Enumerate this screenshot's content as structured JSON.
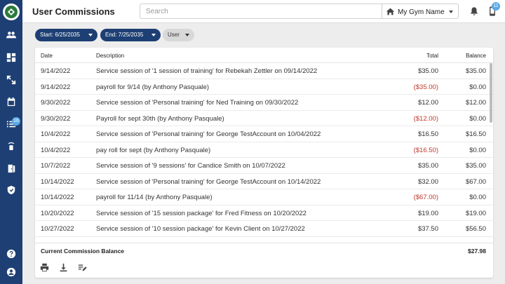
{
  "header": {
    "title": "User Commissions",
    "search_placeholder": "Search",
    "gym_name": "My Gym Name",
    "notification_badge": "11"
  },
  "sidebar": {
    "badge": "16",
    "items": [
      "users-icon",
      "dashboard-icon",
      "expand-icon",
      "calendar-icon",
      "list-icon",
      "access-icon",
      "door-icon",
      "shield-icon",
      "help-icon",
      "account-icon"
    ]
  },
  "filters": {
    "start": "Start: 6/25/2035",
    "end": "End: 7/25/2035",
    "user": "User"
  },
  "table": {
    "columns": {
      "date": "Date",
      "description": "Description",
      "total": "Total",
      "balance": "Balance"
    },
    "rows": [
      {
        "date": "9/14/2022",
        "description": "Service session of '1 session of training' for Rebekah Zettler on 09/14/2022",
        "total": "$35.00",
        "balance": "$35.00",
        "negative": false
      },
      {
        "date": "9/14/2022",
        "description": "payroll for 9/14 (by Anthony Pasquale)",
        "total": "($35.00)",
        "balance": "$0.00",
        "negative": true
      },
      {
        "date": "9/30/2022",
        "description": "Service session of 'Personal training' for Ned Training on 09/30/2022",
        "total": "$12.00",
        "balance": "$12.00",
        "negative": false
      },
      {
        "date": "9/30/2022",
        "description": "Payroll for sept 30th (by Anthony Pasquale)",
        "total": "($12.00)",
        "balance": "$0.00",
        "negative": true
      },
      {
        "date": "10/4/2022",
        "description": "Service session of 'Personal training' for George TestAccount on 10/04/2022",
        "total": "$16.50",
        "balance": "$16.50",
        "negative": false
      },
      {
        "date": "10/4/2022",
        "description": "pay roll for sept (by Anthony Pasquale)",
        "total": "($16.50)",
        "balance": "$0.00",
        "negative": true
      },
      {
        "date": "10/7/2022",
        "description": "Service session of '9 sessions' for Candice Smith on 10/07/2022",
        "total": "$35.00",
        "balance": "$35.00",
        "negative": false
      },
      {
        "date": "10/14/2022",
        "description": "Service session of 'Personal training' for George TestAccount on 10/14/2022",
        "total": "$32.00",
        "balance": "$67.00",
        "negative": false
      },
      {
        "date": "10/14/2022",
        "description": "payroll for 11/14 (by Anthony Pasquale)",
        "total": "($67.00)",
        "balance": "$0.00",
        "negative": true
      },
      {
        "date": "10/20/2022",
        "description": "Service session of '15 session package' for Fred Fitness on 10/20/2022",
        "total": "$19.00",
        "balance": "$19.00",
        "negative": false
      },
      {
        "date": "10/27/2022",
        "description": "Service session of '10 session package' for Kevin Client on 10/27/2022",
        "total": "$37.50",
        "balance": "$56.50",
        "negative": false
      }
    ],
    "summary_label": "Current Commission Balance",
    "summary_value": "$27.98"
  },
  "actions": [
    "print-icon",
    "download-icon",
    "edit-list-icon"
  ],
  "colors": {
    "sidebar": "#1d3f73",
    "negative": "#c0392b",
    "badge": "#5aa9e6"
  }
}
